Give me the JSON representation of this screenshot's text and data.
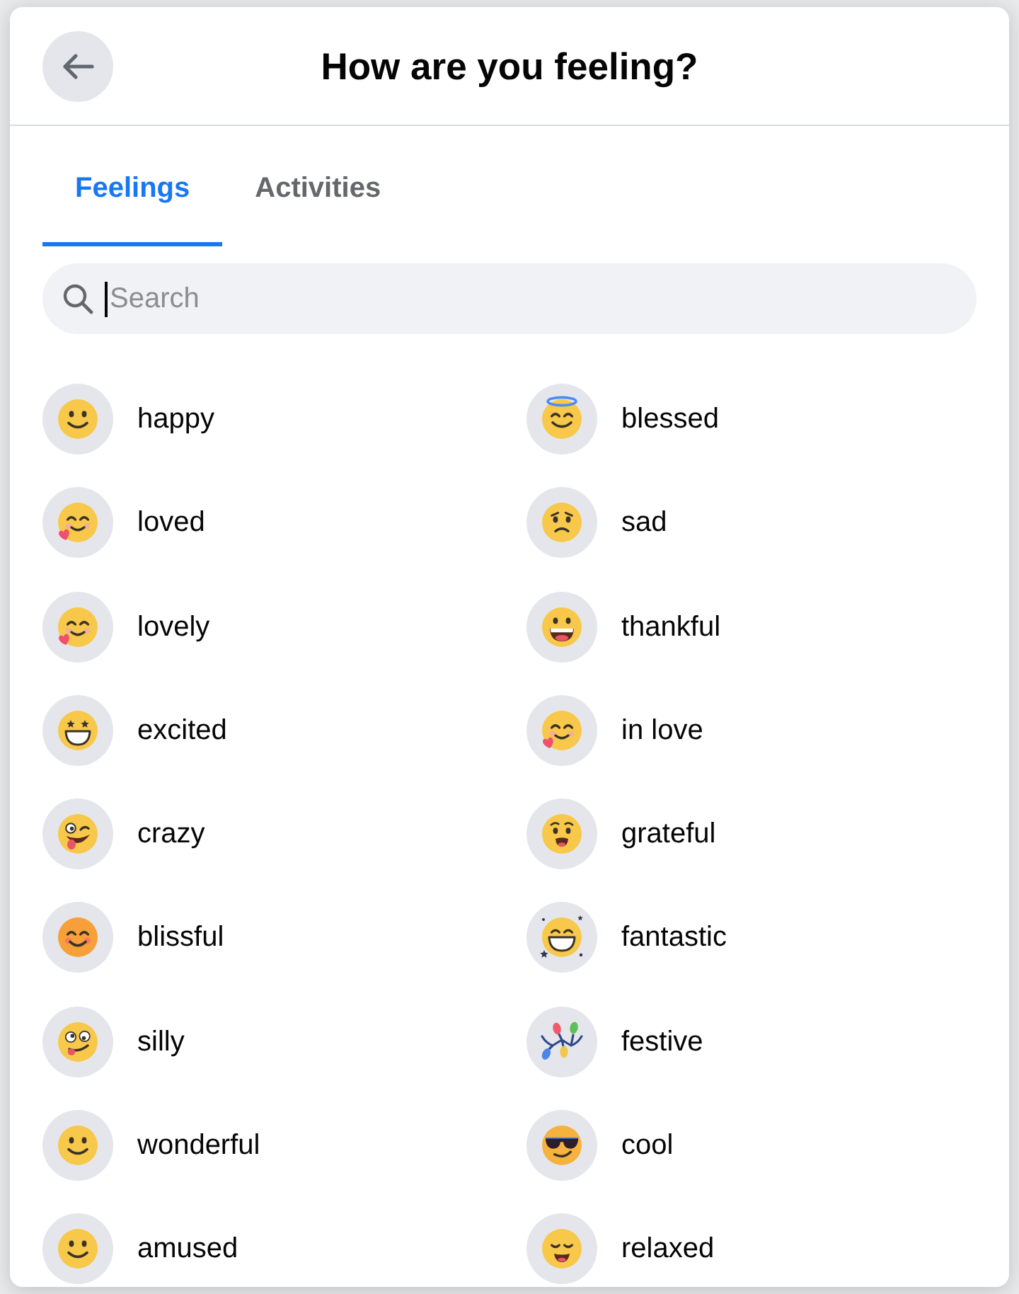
{
  "dialog": {
    "title": "How are you feeling?"
  },
  "tabs": [
    {
      "label": "Feelings",
      "selected": true
    },
    {
      "label": "Activities",
      "selected": false
    }
  ],
  "search": {
    "placeholder": "Search",
    "focused": true
  },
  "feelings": [
    {
      "label": "happy",
      "kind": "smile"
    },
    {
      "label": "blessed",
      "kind": "halo"
    },
    {
      "label": "loved",
      "kind": "hug"
    },
    {
      "label": "sad",
      "kind": "sad"
    },
    {
      "label": "lovely",
      "kind": "hug"
    },
    {
      "label": "thankful",
      "kind": "grin"
    },
    {
      "label": "excited",
      "kind": "stareyes"
    },
    {
      "label": "in love",
      "kind": "hug"
    },
    {
      "label": "crazy",
      "kind": "crazy"
    },
    {
      "label": "grateful",
      "kind": "grateful"
    },
    {
      "label": "blissful",
      "kind": "blush"
    },
    {
      "label": "fantastic",
      "kind": "fantastic"
    },
    {
      "label": "silly",
      "kind": "silly"
    },
    {
      "label": "festive",
      "kind": "festive"
    },
    {
      "label": "wonderful",
      "kind": "smile"
    },
    {
      "label": "cool",
      "kind": "cool"
    },
    {
      "label": "amused",
      "kind": "smile"
    },
    {
      "label": "relaxed",
      "kind": "relaxed"
    }
  ]
}
